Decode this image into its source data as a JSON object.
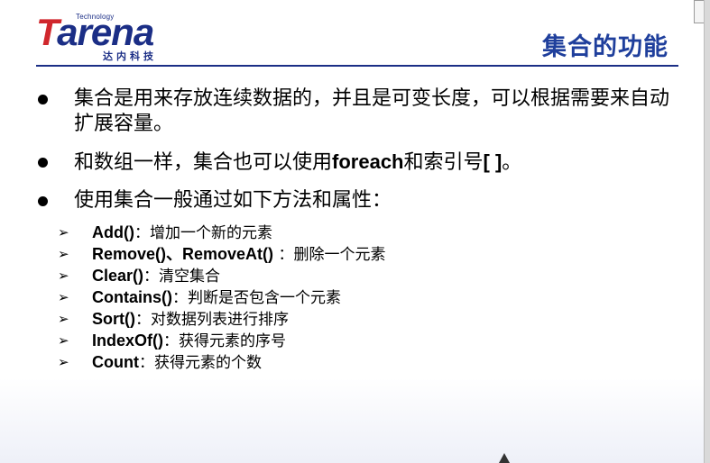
{
  "logo": {
    "tagline": "Technology",
    "word_first": "T",
    "word_rest": "arena",
    "chinese": "达内科技"
  },
  "title": "集合的功能",
  "bullets": [
    {
      "text": "集合是用来存放连续数据的，并且是可变长度，可以根据需要来自动扩展容量。"
    },
    {
      "pre": "和数组一样，集合也可以使用",
      "bold": "foreach",
      "mid": "和索引号",
      "bold2": "[ ]",
      "post": "。"
    },
    {
      "text": "使用集合一般通过如下方法和属性："
    }
  ],
  "items": [
    {
      "code": "Add()",
      "sep": "：",
      "desc": "增加一个新的元素"
    },
    {
      "code": "Remove()、RemoveAt()",
      "sep": " ：",
      "desc": "删除一个元素"
    },
    {
      "code": "Clear()",
      "sep": "：",
      "desc": "清空集合"
    },
    {
      "code": "Contains()",
      "sep": "：",
      "desc": "判断是否包含一个元素"
    },
    {
      "code": "Sort()",
      "sep": "：",
      "desc": "对数据列表进行排序"
    },
    {
      "code": "IndexOf()",
      "sep": "：",
      "desc": "获得元素的序号"
    },
    {
      "code": "Count",
      "sep": "：",
      "desc": "获得元素的个数"
    }
  ],
  "icons": {
    "bullet": "filled-circle-icon",
    "sub_bullet": "arrow-right-icon",
    "cursor": "mouse-cursor-icon"
  },
  "colors": {
    "title": "#1f3f9c",
    "logo_blue": "#1b2e86",
    "logo_red": "#d0272d"
  }
}
